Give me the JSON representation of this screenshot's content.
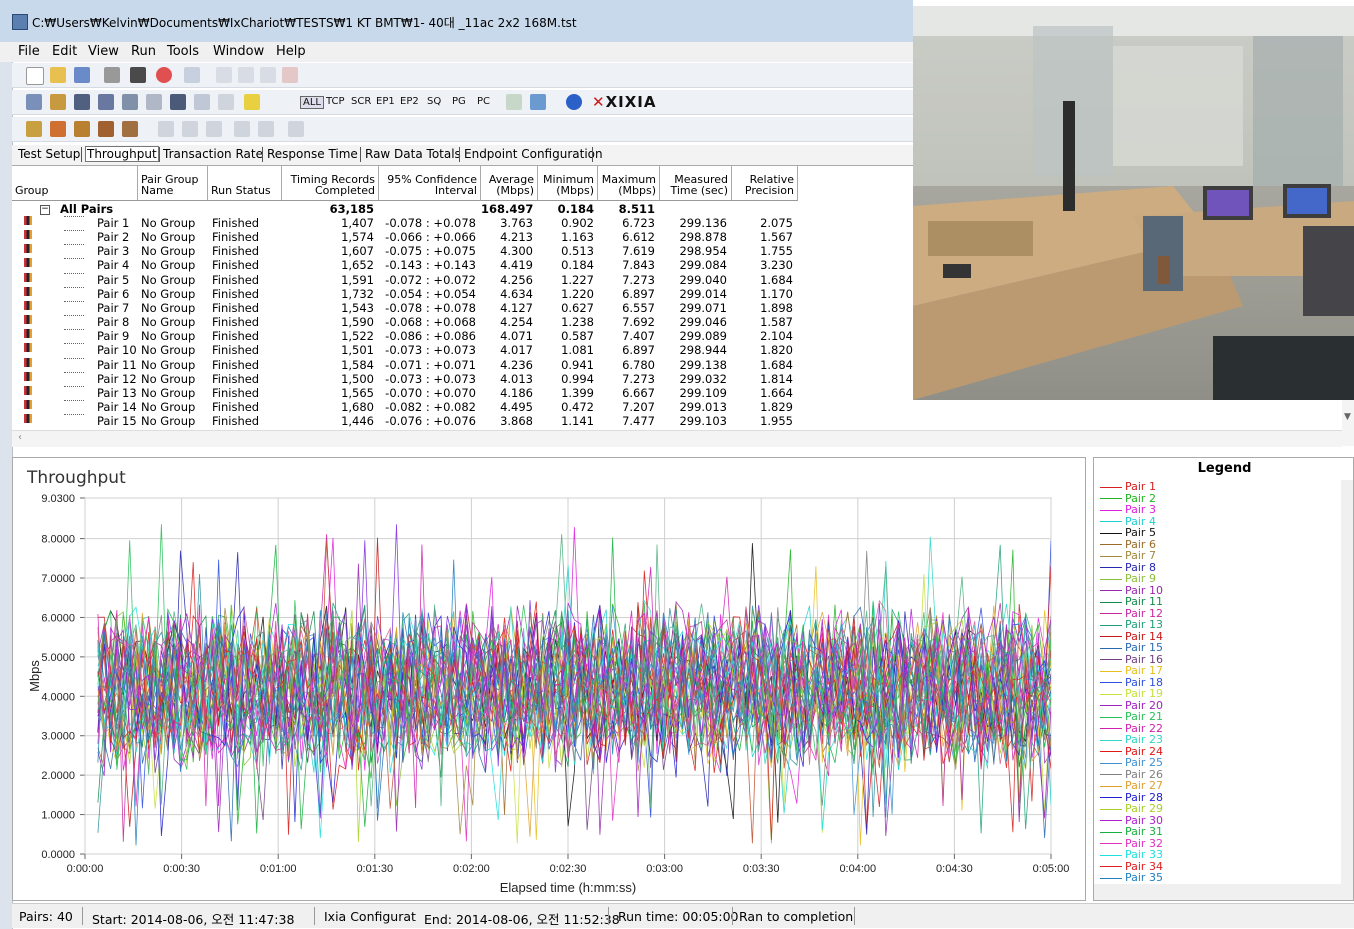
{
  "window": {
    "title": "C:₩Users₩Kelvin₩Documents₩IxChariot₩TESTS₩1 KT BMT₩1- 40대 _11ac 2x2 168M.tst"
  },
  "menu": [
    "File",
    "Edit",
    "View",
    "Run",
    "Tools",
    "Window",
    "Help"
  ],
  "toolbar2_filters": [
    "ALL",
    "TCP",
    "SCR",
    "EP1",
    "EP2",
    "SQ",
    "PG",
    "PC"
  ],
  "brand": "XIXIA",
  "tabs": [
    "Test Setup",
    "Throughput",
    "Transaction Rate",
    "Response Time",
    "Raw Data Totals",
    "Endpoint Configuration"
  ],
  "active_tab": "Throughput",
  "table": {
    "headers": [
      {
        "l1": "",
        "l2": "Group"
      },
      {
        "l1": "Pair Group",
        "l2": "Name"
      },
      {
        "l1": "",
        "l2": "Run Status"
      },
      {
        "l1": "Timing Records",
        "l2": "Completed"
      },
      {
        "l1": "95% Confidence",
        "l2": "Interval"
      },
      {
        "l1": "Average",
        "l2": "(Mbps)"
      },
      {
        "l1": "Minimum",
        "l2": "(Mbps)"
      },
      {
        "l1": "Maximum",
        "l2": "(Mbps)"
      },
      {
        "l1": "Measured",
        "l2": "Time (sec)"
      },
      {
        "l1": "Relative",
        "l2": "Precision"
      }
    ],
    "summary": {
      "label": "All Pairs",
      "records": "63,185",
      "average": "168.497",
      "minimum": "0.184",
      "maximum": "8.511"
    },
    "rows": [
      {
        "pair": "Pair 1",
        "group": "No Group",
        "status": "Finished",
        "records": "1,407",
        "ci": "-0.078 : +0.078",
        "avg": "3.763",
        "min": "0.902",
        "max": "6.723",
        "time": "299.136",
        "prec": "2.075"
      },
      {
        "pair": "Pair 2",
        "group": "No Group",
        "status": "Finished",
        "records": "1,574",
        "ci": "-0.066 : +0.066",
        "avg": "4.213",
        "min": "1.163",
        "max": "6.612",
        "time": "298.878",
        "prec": "1.567"
      },
      {
        "pair": "Pair 3",
        "group": "No Group",
        "status": "Finished",
        "records": "1,607",
        "ci": "-0.075 : +0.075",
        "avg": "4.300",
        "min": "0.513",
        "max": "7.619",
        "time": "298.954",
        "prec": "1.755"
      },
      {
        "pair": "Pair 4",
        "group": "No Group",
        "status": "Finished",
        "records": "1,652",
        "ci": "-0.143 : +0.143",
        "avg": "4.419",
        "min": "0.184",
        "max": "7.843",
        "time": "299.084",
        "prec": "3.230"
      },
      {
        "pair": "Pair 5",
        "group": "No Group",
        "status": "Finished",
        "records": "1,591",
        "ci": "-0.072 : +0.072",
        "avg": "4.256",
        "min": "1.227",
        "max": "7.273",
        "time": "299.040",
        "prec": "1.684"
      },
      {
        "pair": "Pair 6",
        "group": "No Group",
        "status": "Finished",
        "records": "1,732",
        "ci": "-0.054 : +0.054",
        "avg": "4.634",
        "min": "1.220",
        "max": "6.897",
        "time": "299.014",
        "prec": "1.170"
      },
      {
        "pair": "Pair 7",
        "group": "No Group",
        "status": "Finished",
        "records": "1,543",
        "ci": "-0.078 : +0.078",
        "avg": "4.127",
        "min": "0.627",
        "max": "6.557",
        "time": "299.071",
        "prec": "1.898"
      },
      {
        "pair": "Pair 8",
        "group": "No Group",
        "status": "Finished",
        "records": "1,590",
        "ci": "-0.068 : +0.068",
        "avg": "4.254",
        "min": "1.238",
        "max": "7.692",
        "time": "299.046",
        "prec": "1.587"
      },
      {
        "pair": "Pair 9",
        "group": "No Group",
        "status": "Finished",
        "records": "1,522",
        "ci": "-0.086 : +0.086",
        "avg": "4.071",
        "min": "0.587",
        "max": "7.407",
        "time": "299.089",
        "prec": "2.104"
      },
      {
        "pair": "Pair 10",
        "group": "No Group",
        "status": "Finished",
        "records": "1,501",
        "ci": "-0.073 : +0.073",
        "avg": "4.017",
        "min": "1.081",
        "max": "6.897",
        "time": "298.944",
        "prec": "1.820"
      },
      {
        "pair": "Pair 11",
        "group": "No Group",
        "status": "Finished",
        "records": "1,584",
        "ci": "-0.071 : +0.071",
        "avg": "4.236",
        "min": "0.941",
        "max": "6.780",
        "time": "299.138",
        "prec": "1.684"
      },
      {
        "pair": "Pair 12",
        "group": "No Group",
        "status": "Finished",
        "records": "1,500",
        "ci": "-0.073 : +0.073",
        "avg": "4.013",
        "min": "0.994",
        "max": "7.273",
        "time": "299.032",
        "prec": "1.814"
      },
      {
        "pair": "Pair 13",
        "group": "No Group",
        "status": "Finished",
        "records": "1,565",
        "ci": "-0.070 : +0.070",
        "avg": "4.186",
        "min": "1.399",
        "max": "6.667",
        "time": "299.109",
        "prec": "1.664"
      },
      {
        "pair": "Pair 14",
        "group": "No Group",
        "status": "Finished",
        "records": "1,680",
        "ci": "-0.082 : +0.082",
        "avg": "4.495",
        "min": "0.472",
        "max": "7.207",
        "time": "299.013",
        "prec": "1.829"
      },
      {
        "pair": "Pair 15",
        "group": "No Group",
        "status": "Finished",
        "records": "1,446",
        "ci": "-0.076 : +0.076",
        "avg": "3.868",
        "min": "1.141",
        "max": "7.477",
        "time": "299.103",
        "prec": "1.955"
      }
    ]
  },
  "chart_data": {
    "type": "line",
    "title": "Throughput",
    "xlabel": "Elapsed time (h:mm:ss)",
    "ylabel": "Mbps",
    "x_ticks": [
      "0:00:00",
      "0:00:30",
      "0:01:00",
      "0:01:30",
      "0:02:00",
      "0:02:30",
      "0:03:00",
      "0:03:30",
      "0:04:00",
      "0:04:30",
      "0:05:00"
    ],
    "y_ticks": [
      "0.0000",
      "1.0000",
      "2.0000",
      "3.0000",
      "4.0000",
      "5.0000",
      "6.0000",
      "7.0000",
      "8.0000",
      "9.0300"
    ],
    "ylim": [
      0,
      9.03
    ],
    "xlim_seconds": [
      0,
      300
    ],
    "grid": true,
    "series_count": 40,
    "series_mean_mbps": 4.2,
    "series_range_mbps": [
      0.184,
      8.511
    ]
  },
  "legend": {
    "title": "Legend",
    "items": [
      {
        "name": "Pair 1",
        "color": "#d62020"
      },
      {
        "name": "Pair 2",
        "color": "#22b522"
      },
      {
        "name": "Pair 3",
        "color": "#e020e0"
      },
      {
        "name": "Pair 4",
        "color": "#20d0d0"
      },
      {
        "name": "Pair 5",
        "color": "#111111"
      },
      {
        "name": "Pair 6",
        "color": "#9a6b28"
      },
      {
        "name": "Pair 7",
        "color": "#a08840"
      },
      {
        "name": "Pair 8",
        "color": "#2828b0"
      },
      {
        "name": "Pair 9",
        "color": "#8cbf3a"
      },
      {
        "name": "Pair 10",
        "color": "#9928b0"
      },
      {
        "name": "Pair 11",
        "color": "#158a4a"
      },
      {
        "name": "Pair 12",
        "color": "#c828a0"
      },
      {
        "name": "Pair 13",
        "color": "#1fa07a"
      },
      {
        "name": "Pair 14",
        "color": "#c41818"
      },
      {
        "name": "Pair 15",
        "color": "#2a6ab0"
      },
      {
        "name": "Pair 16",
        "color": "#704080"
      },
      {
        "name": "Pair 17",
        "color": "#e8c020"
      },
      {
        "name": "Pair 18",
        "color": "#3050e0"
      },
      {
        "name": "Pair 19",
        "color": "#c8e040"
      },
      {
        "name": "Pair 20",
        "color": "#a020c0"
      },
      {
        "name": "Pair 21",
        "color": "#28c058"
      },
      {
        "name": "Pair 22",
        "color": "#d020b0"
      },
      {
        "name": "Pair 23",
        "color": "#30d8c8"
      },
      {
        "name": "Pair 24",
        "color": "#e01818"
      },
      {
        "name": "Pair 25",
        "color": "#4090d0"
      },
      {
        "name": "Pair 26",
        "color": "#808080"
      },
      {
        "name": "Pair 27",
        "color": "#e0a030"
      },
      {
        "name": "Pair 28",
        "color": "#2020d0"
      },
      {
        "name": "Pair 29",
        "color": "#a8d028"
      },
      {
        "name": "Pair 30",
        "color": "#b020d0"
      },
      {
        "name": "Pair 31",
        "color": "#18b040"
      },
      {
        "name": "Pair 32",
        "color": "#e030c0"
      },
      {
        "name": "Pair 33",
        "color": "#20e0e0"
      },
      {
        "name": "Pair 34",
        "color": "#e02020"
      },
      {
        "name": "Pair 35",
        "color": "#2080c0"
      }
    ]
  },
  "status": {
    "pairs": "Pairs: 40",
    "start": "Start: 2014-08-06, 오전 11:47:38",
    "config": "Ixia Configurat",
    "end": "End: 2014-08-06, 오전 11:52:38",
    "runtime": "Run time: 00:05:00",
    "result": "Ran to completion"
  }
}
